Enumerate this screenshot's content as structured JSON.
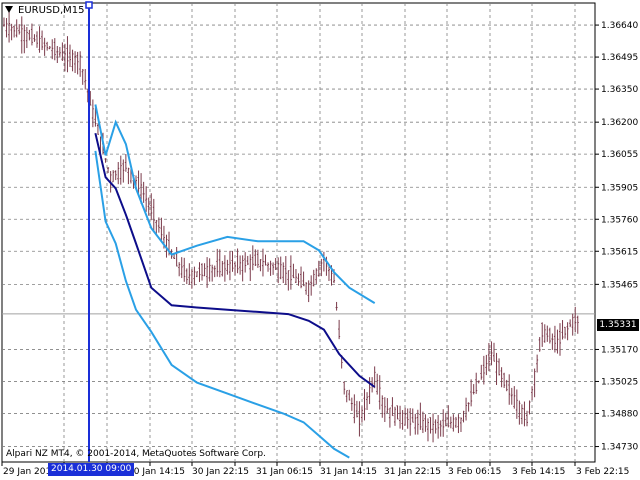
{
  "window": {
    "symbol": "EURUSD,M15",
    "copyright": "Alpari NZ MT4, © 2001-2014, MetaQuotes Software Corp.",
    "current_price": "1.35331",
    "cursor_time": "2014.01.30 09:00"
  },
  "colors": {
    "background": "#ffffff",
    "grid": "#808080",
    "candles": "#7a3a4a",
    "ma_line": "#0d0d8a",
    "bands": "#2aa0e6",
    "cursor": "#1a2fd8",
    "price_line": "#a0a0a0"
  },
  "chart_data": {
    "type": "candlestick",
    "ylim": [
      1.3466,
      1.3674
    ],
    "y_ticks": [
      "1.36640",
      "1.36495",
      "1.36350",
      "1.36200",
      "1.36055",
      "1.35905",
      "1.35760",
      "1.35615",
      "1.35465",
      "1.35170",
      "1.35025",
      "1.34880",
      "1.34730"
    ],
    "x_ticks": [
      "29 Jan 2014",
      "30 Jan 14:15",
      "30 Jan 22:15",
      "31 Jan 06:15",
      "31 Jan 14:15",
      "31 Jan 22:15",
      "3 Feb 06:15",
      "3 Feb 14:15",
      "3 Feb 22:15"
    ],
    "price_line": 1.35331,
    "close_path": [
      [
        0,
        1.3664
      ],
      [
        8,
        1.366
      ],
      [
        16,
        1.3655
      ],
      [
        24,
        1.365
      ],
      [
        30,
        1.3648
      ],
      [
        36,
        1.362
      ],
      [
        42,
        1.3595
      ],
      [
        48,
        1.36
      ],
      [
        54,
        1.359
      ],
      [
        60,
        1.3575
      ],
      [
        66,
        1.356
      ],
      [
        72,
        1.355
      ],
      [
        80,
        1.3553
      ],
      [
        90,
        1.3555
      ],
      [
        100,
        1.3557
      ],
      [
        110,
        1.3553
      ],
      [
        120,
        1.3545
      ],
      [
        126,
        1.3558
      ],
      [
        130,
        1.3548
      ],
      [
        134,
        1.35
      ],
      [
        140,
        1.3485
      ],
      [
        146,
        1.3505
      ],
      [
        150,
        1.349
      ],
      [
        160,
        1.3485
      ],
      [
        170,
        1.3482
      ],
      [
        180,
        1.3485
      ],
      [
        186,
        1.35
      ],
      [
        192,
        1.3515
      ],
      [
        198,
        1.35
      ],
      [
        206,
        1.3485
      ],
      [
        212,
        1.3525
      ],
      [
        218,
        1.352
      ],
      [
        224,
        1.353
      ]
    ],
    "moving_average": [
      [
        36,
        1.3615
      ],
      [
        40,
        1.3595
      ],
      [
        44,
        1.359
      ],
      [
        48,
        1.3578
      ],
      [
        52,
        1.3565
      ],
      [
        58,
        1.3545
      ],
      [
        66,
        1.3537
      ],
      [
        76,
        1.3536
      ],
      [
        88,
        1.3535
      ],
      [
        100,
        1.3534
      ],
      [
        112,
        1.3533
      ],
      [
        120,
        1.353
      ],
      [
        126,
        1.3526
      ],
      [
        132,
        1.3515
      ],
      [
        140,
        1.3505
      ],
      [
        146,
        1.35
      ]
    ],
    "upper_band": [
      [
        36,
        1.3628
      ],
      [
        40,
        1.3605
      ],
      [
        44,
        1.362
      ],
      [
        48,
        1.361
      ],
      [
        52,
        1.359
      ],
      [
        58,
        1.3572
      ],
      [
        66,
        1.356
      ],
      [
        76,
        1.3564
      ],
      [
        88,
        1.3568
      ],
      [
        100,
        1.3566
      ],
      [
        110,
        1.3566
      ],
      [
        118,
        1.3566
      ],
      [
        124,
        1.3562
      ],
      [
        130,
        1.3552
      ],
      [
        136,
        1.3545
      ],
      [
        146,
        1.3538
      ]
    ],
    "lower_band": [
      [
        36,
        1.3607
      ],
      [
        40,
        1.3575
      ],
      [
        44,
        1.3565
      ],
      [
        48,
        1.3548
      ],
      [
        52,
        1.3535
      ],
      [
        58,
        1.3525
      ],
      [
        66,
        1.351
      ],
      [
        76,
        1.3502
      ],
      [
        88,
        1.3497
      ],
      [
        100,
        1.3492
      ],
      [
        110,
        1.3488
      ],
      [
        118,
        1.3484
      ],
      [
        124,
        1.3478
      ],
      [
        130,
        1.3472
      ],
      [
        136,
        1.3468
      ]
    ]
  }
}
